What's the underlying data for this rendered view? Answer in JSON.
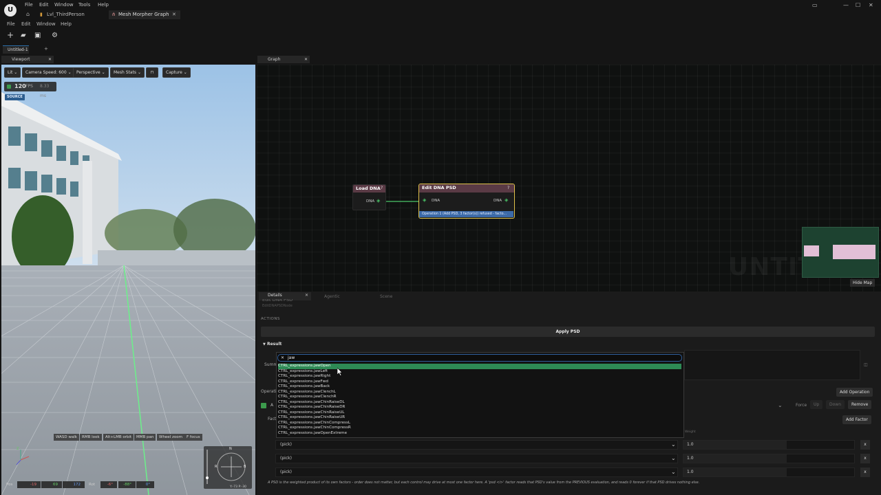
{
  "titlebar": {
    "menu": [
      "File",
      "Edit",
      "Window",
      "Tools",
      "Help"
    ],
    "tabs": [
      {
        "label": "Lvl_ThirdPerson",
        "active": false
      },
      {
        "label": "Mesh Morpher Graph",
        "active": true
      }
    ]
  },
  "menubar": [
    "File",
    "Edit",
    "Window",
    "Help"
  ],
  "document_tab": {
    "label": "Untitled-1"
  },
  "viewport": {
    "tab_label": "Viewport",
    "toolbar": {
      "lit": "Lit",
      "camera_speed": "Camera Speed: 600",
      "perspective": "Perspective",
      "mesh_stats": "Mesh Stats",
      "capture": "Capture"
    },
    "fps_value": "120",
    "fps_unit": "FPS",
    "frame_ms": "8.33 ms",
    "source_badge": "SOURCE",
    "hints": [
      "WASD walk",
      "RMB look",
      "Alt+LMB orbit",
      "MMB pan",
      "Wheel zoom",
      "F focus"
    ],
    "coords": {
      "pos_label": "Pos",
      "pos": [
        "-19",
        "69",
        "172"
      ],
      "rot_label": "Rot",
      "rot": [
        "-6°",
        "-88°",
        "0°"
      ],
      "compass_readout": "Y:-73 P:-30"
    }
  },
  "graph": {
    "tab_label": "Graph",
    "nodes": {
      "load": {
        "title": "Load DNA",
        "help": "?",
        "out_pin": "DNA"
      },
      "edit": {
        "title": "Edit DNA PSD",
        "help": "?",
        "in_pin": "DNA",
        "out_pin": "DNA",
        "status": "Operation 1 (Add PSD, 3 factor(s)) refused - facto..."
      }
    },
    "watermark": "UNTIT",
    "hide_map": "Hide Map"
  },
  "details": {
    "tabs": [
      "Details",
      "Agentic",
      "Scene"
    ],
    "header": "Edit DNA PSD",
    "subheader": "EditDNAPSDNode",
    "actions_label": "ACTIONS",
    "apply_button": "Apply PSD",
    "result_label": "Result",
    "summary_label": "Summ",
    "operations_label": "Operatio",
    "factors_label": "Facto",
    "add_operation": "Add Operation",
    "force_label": "Force",
    "up": "Up",
    "down": "Down",
    "remove": "Remove",
    "add_factor": "Add Factor",
    "weight_label": "Weight",
    "factors": [
      {
        "pick": "(pick)",
        "weight": "1.0",
        "remove": "x"
      },
      {
        "pick": "(pick)",
        "weight": "1.0",
        "remove": "x"
      },
      {
        "pick": "(pick)",
        "weight": "1.0",
        "remove": "x"
      }
    ],
    "help_text": "A PSD is the weighted product of its own factors - order does not matter, but each control may drive at most one factor here. A 'psd <i>' factor reads that PSD's value from the PREVIOUS evaluation, and reads 0 forever if that PSD drives nothing else."
  },
  "dropdown": {
    "clear": "✕",
    "search_value": "jaw",
    "items": [
      "CTRL_expressions.jawOpen",
      "CTRL_expressions.jawLeft",
      "CTRL_expressions.jawRight",
      "CTRL_expressions.jawFwd",
      "CTRL_expressions.jawBack",
      "CTRL_expressions.jawClenchL",
      "CTRL_expressions.jawClenchR",
      "CTRL_expressions.jawChinRaiseDL",
      "CTRL_expressions.jawChinRaiseDR",
      "CTRL_expressions.jawChinRaiseUL",
      "CTRL_expressions.jawChinRaiseUR",
      "CTRL_expressions.jawChinCompressL",
      "CTRL_expressions.jawChinCompressR",
      "CTRL_expressions.jawOpenExtreme"
    ],
    "selected_index": 0
  },
  "colors": {
    "accent_blue": "#2f5f9e",
    "selection_green": "#2e8a55",
    "node_select_yellow": "#e0c24a",
    "wire_green": "#4cc86a"
  }
}
